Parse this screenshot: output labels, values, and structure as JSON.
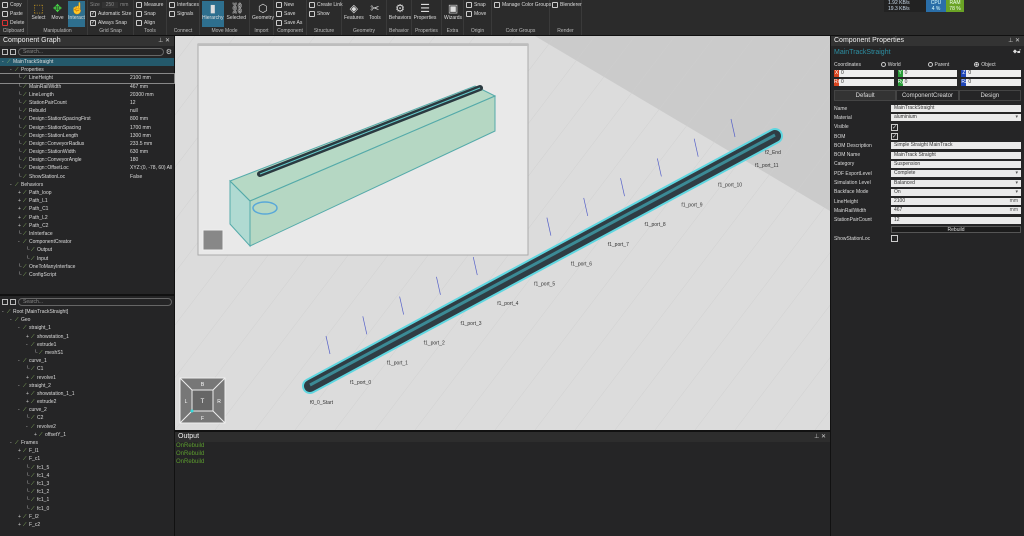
{
  "ribbon": {
    "groups": [
      {
        "label": "Clipboard",
        "small": [
          "Copy",
          "Paste",
          "Delete"
        ]
      },
      {
        "label": "Manipulation",
        "big": [
          "Select",
          "Move",
          "Interact"
        ],
        "active": "Interact"
      },
      {
        "label": "Grid Snap",
        "size_label": "Size",
        "size_value": "250",
        "size_unit": "mm",
        "small": [
          "Automatic Size",
          "Always Snap"
        ]
      },
      {
        "label": "Tools",
        "small": [
          "Measure",
          "Snap",
          "Align"
        ]
      },
      {
        "label": "Connect",
        "small": [
          "Interfaces",
          "Signals"
        ]
      },
      {
        "label": "Move Mode",
        "big": [
          "Hierarchy",
          "Selected"
        ],
        "active": "Hierarchy"
      },
      {
        "label": "Import",
        "big": [
          "Geometry"
        ]
      },
      {
        "label": "Component",
        "small": [
          "New",
          "Save",
          "Save As"
        ]
      },
      {
        "label": "Structure",
        "small": [
          "Create Link",
          "Show"
        ]
      },
      {
        "label": "Geometry",
        "big": [
          "Features",
          "Tools"
        ]
      },
      {
        "label": "Behavior",
        "big": [
          "Behaviors"
        ]
      },
      {
        "label": "Properties",
        "big": [
          "Properties"
        ]
      },
      {
        "label": "Extra",
        "big": [
          "Wizards"
        ]
      },
      {
        "label": "Origin",
        "small": [
          "Snap",
          "Move"
        ]
      },
      {
        "label": "Color Groups",
        "small": [
          "Manage Color Groups"
        ]
      },
      {
        "label": "Render",
        "small": [
          "Blenderer"
        ]
      }
    ],
    "net": {
      "up": "1.92 KB/s",
      "down": "19.3 KB/s",
      "cpu_label": "CPU",
      "cpu": "4 %",
      "ram_label": "RAM",
      "ram": "78 %"
    }
  },
  "component_graph": {
    "title": "Component Graph",
    "search_placeholder": "Search...",
    "tree": [
      {
        "d": 0,
        "t": "-",
        "label": "MainTrackStraight",
        "sel": true
      },
      {
        "d": 1,
        "t": "-",
        "label": "Properties"
      },
      {
        "d": 2,
        "label": "LineHeight",
        "value": "2100 mm",
        "hl": true
      },
      {
        "d": 2,
        "label": "MainRailWidth",
        "value": "467 mm"
      },
      {
        "d": 2,
        "label": "LineLength",
        "value": "20300 mm"
      },
      {
        "d": 2,
        "label": "StationPairCount",
        "value": "12"
      },
      {
        "d": 2,
        "label": "Rebuild",
        "value": "null"
      },
      {
        "d": 2,
        "label": "Design::StationSpacingFirst",
        "value": "800 mm"
      },
      {
        "d": 2,
        "label": "Design::StationSpacing",
        "value": "1700 mm"
      },
      {
        "d": 2,
        "label": "Design::StationLength",
        "value": "1300 mm"
      },
      {
        "d": 2,
        "label": "Design::ConveyorRadius",
        "value": "233.5 mm"
      },
      {
        "d": 2,
        "label": "Design::StationWidth",
        "value": "630 mm"
      },
      {
        "d": 2,
        "label": "Design::ConveyorAngle",
        "value": "180"
      },
      {
        "d": 2,
        "label": "Design::OffsetLoc",
        "value": "XYZ:(0, -78, 60) All"
      },
      {
        "d": 2,
        "label": "ShowStationLoc",
        "value": "False"
      },
      {
        "d": 1,
        "t": "-",
        "label": "Behaviors"
      },
      {
        "d": 2,
        "t": "+",
        "label": "Path_loop"
      },
      {
        "d": 2,
        "t": "+",
        "label": "Path_L1"
      },
      {
        "d": 2,
        "t": "+",
        "label": "Path_C1"
      },
      {
        "d": 2,
        "t": "+",
        "label": "Path_L2"
      },
      {
        "d": 2,
        "t": "+",
        "label": "Path_C2"
      },
      {
        "d": 2,
        "label": "InInterface"
      },
      {
        "d": 2,
        "t": "-",
        "label": "ComponentCreator"
      },
      {
        "d": 3,
        "label": "Output"
      },
      {
        "d": 3,
        "label": "Input"
      },
      {
        "d": 2,
        "label": "OneToManyInterface"
      },
      {
        "d": 2,
        "label": "ConfigScript"
      }
    ]
  },
  "node_tree": {
    "search_placeholder": "Search...",
    "tree": [
      {
        "d": 0,
        "t": "-",
        "label": "Root [MainTrackStraight]"
      },
      {
        "d": 1,
        "t": "-",
        "label": "Geo"
      },
      {
        "d": 2,
        "t": "-",
        "label": "straight_1"
      },
      {
        "d": 3,
        "t": "+",
        "label": "showstation_1"
      },
      {
        "d": 3,
        "t": "-",
        "label": "extrude1"
      },
      {
        "d": 4,
        "label": "meshS1"
      },
      {
        "d": 2,
        "t": "-",
        "label": "curve_1"
      },
      {
        "d": 3,
        "label": "C1"
      },
      {
        "d": 3,
        "t": "+",
        "label": "revolve1"
      },
      {
        "d": 2,
        "t": "-",
        "label": "straight_2"
      },
      {
        "d": 3,
        "t": "+",
        "label": "showstation_1_1"
      },
      {
        "d": 3,
        "t": "+",
        "label": "extrude2"
      },
      {
        "d": 2,
        "t": "-",
        "label": "curve_2"
      },
      {
        "d": 3,
        "label": "C2"
      },
      {
        "d": 3,
        "t": "-",
        "label": "revolve2"
      },
      {
        "d": 4,
        "t": "+",
        "label": "offsetY_1"
      },
      {
        "d": 1,
        "t": "-",
        "label": "Frames"
      },
      {
        "d": 2,
        "t": "+",
        "label": "F_l1"
      },
      {
        "d": 2,
        "t": "-",
        "label": "F_c1"
      },
      {
        "d": 3,
        "label": "fc1_5"
      },
      {
        "d": 3,
        "label": "fc1_4"
      },
      {
        "d": 3,
        "label": "fc1_3"
      },
      {
        "d": 3,
        "label": "fc1_2"
      },
      {
        "d": 3,
        "label": "fc1_1"
      },
      {
        "d": 3,
        "label": "fc1_0"
      },
      {
        "d": 2,
        "t": "+",
        "label": "F_l2"
      },
      {
        "d": 2,
        "t": "+",
        "label": "F_c2"
      }
    ]
  },
  "viewport": {
    "ports": [
      "f1_port_0",
      "f1_port_1",
      "f1_port_2",
      "f1_port_3",
      "f1_port_4",
      "f1_port_5",
      "f1_port_6",
      "f1_port_7",
      "f1_port_8",
      "f1_port_9",
      "f1_port_10",
      "f1_port_11"
    ],
    "start_label": "f0_0_Start",
    "end_label": "f2_End",
    "nav_cube": {
      "top": "B",
      "left": "L",
      "center": "T",
      "right": "R",
      "bottom": "F"
    }
  },
  "output": {
    "title": "Output",
    "lines": [
      "OnRebuild",
      "OnRebuild",
      "OnRebuild"
    ]
  },
  "properties": {
    "title": "Component Properties",
    "component_name": "MainTrackStraight",
    "coordinates_label": "Coordinates",
    "coord_modes": [
      "World",
      "Parent",
      "Object"
    ],
    "coord_selected": "Object",
    "fields": [
      {
        "k": "X",
        "v": "0",
        "c": "#d9451f"
      },
      {
        "k": "Y",
        "v": "0",
        "c": "#2a9d3a"
      },
      {
        "k": "Z",
        "v": "0",
        "c": "#1f46b8"
      },
      {
        "k": "Rx",
        "v": "0",
        "c": "#d9451f"
      },
      {
        "k": "Ry",
        "v": "0",
        "c": "#2a9d3a"
      },
      {
        "k": "Rz",
        "v": "0",
        "c": "#1f46b8"
      }
    ],
    "tabs": [
      "Default",
      "ComponentCreator",
      "Design"
    ],
    "active_tab": "Default",
    "rows": [
      {
        "label": "Name",
        "type": "text",
        "value": "MainTrackStraight"
      },
      {
        "label": "Material",
        "type": "select",
        "value": "aluminium"
      },
      {
        "label": "Visible",
        "type": "check",
        "checked": true
      },
      {
        "label": "BOM",
        "type": "check",
        "checked": true
      },
      {
        "label": "BOM Description",
        "type": "text",
        "value": "Simple Straight MainTrack"
      },
      {
        "label": "BOM Name",
        "type": "text",
        "value": "MainTrack Straight"
      },
      {
        "label": "Category",
        "type": "text",
        "value": "Suspension"
      },
      {
        "label": "PDF ExportLevel",
        "type": "select",
        "value": "Complete"
      },
      {
        "label": "Simulation Level",
        "type": "select",
        "value": "Balanced"
      },
      {
        "label": "Backface Mode",
        "type": "select",
        "value": "On"
      },
      {
        "label": "LineHeight",
        "type": "unit",
        "value": "2100",
        "unit": "mm"
      },
      {
        "label": "MainRailWidth",
        "type": "unit",
        "value": "467",
        "unit": "mm"
      },
      {
        "label": "StationPairCount",
        "type": "text",
        "value": "12"
      },
      {
        "label": "",
        "type": "button",
        "value": "Rebuild"
      },
      {
        "label": "ShowStationLoc",
        "type": "check",
        "checked": false
      }
    ]
  }
}
